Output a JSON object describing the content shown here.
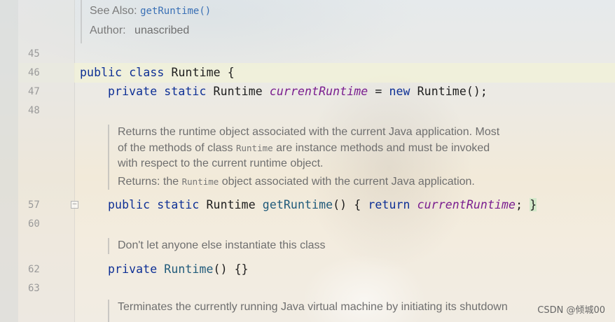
{
  "javadoc_top": {
    "see_also_label": "See Also:",
    "see_also_link": "getRuntime()",
    "author_label": "Author:",
    "author_value": "unascribed"
  },
  "line_numbers": {
    "l45": "45",
    "l46": "46",
    "l47": "47",
    "l48": "48",
    "l57": "57",
    "l60": "60",
    "l62": "62",
    "l63": "63"
  },
  "code": {
    "line46": {
      "kw1": "public",
      "kw2": "class",
      "name": "Runtime",
      "brace": "{"
    },
    "line47": {
      "kw1": "private",
      "kw2": "static",
      "type": "Runtime",
      "field": "currentRuntime",
      "eq": "=",
      "kw3": "new",
      "ctor": "Runtime();"
    },
    "line57": {
      "kw1": "public",
      "kw2": "static",
      "type": "Runtime",
      "method": "getRuntime",
      "parens": "()",
      "open_brace": "{",
      "kw3": "return",
      "field": "currentRuntime",
      "semi": ";",
      "close_brace": "}"
    },
    "line62": {
      "kw1": "private",
      "ctor": "Runtime",
      "rest": "() {}"
    }
  },
  "doc_block_1": {
    "line1": "Returns the runtime object associated with the current Java application. Most",
    "line2_pre": "of the methods of class",
    "line2_code": "Runtime",
    "line2_post": "are instance methods and must be invoked",
    "line3": "with respect to the current runtime object.",
    "returns_label": "Returns:",
    "returns_pre": "the",
    "returns_code": "Runtime",
    "returns_post": "object associated with the current Java application."
  },
  "doc_block_2": {
    "line1": "Don't let anyone else instantiate this class"
  },
  "doc_block_3": {
    "line1": "Terminates the currently running Java virtual machine by initiating its shutdown"
  },
  "watermark": "CSDN @倾城00",
  "colors": {
    "keyword": "#0d2f95",
    "field": "#7a1d8f",
    "link": "#3a70b5",
    "current_line": "#f2f2d7"
  }
}
